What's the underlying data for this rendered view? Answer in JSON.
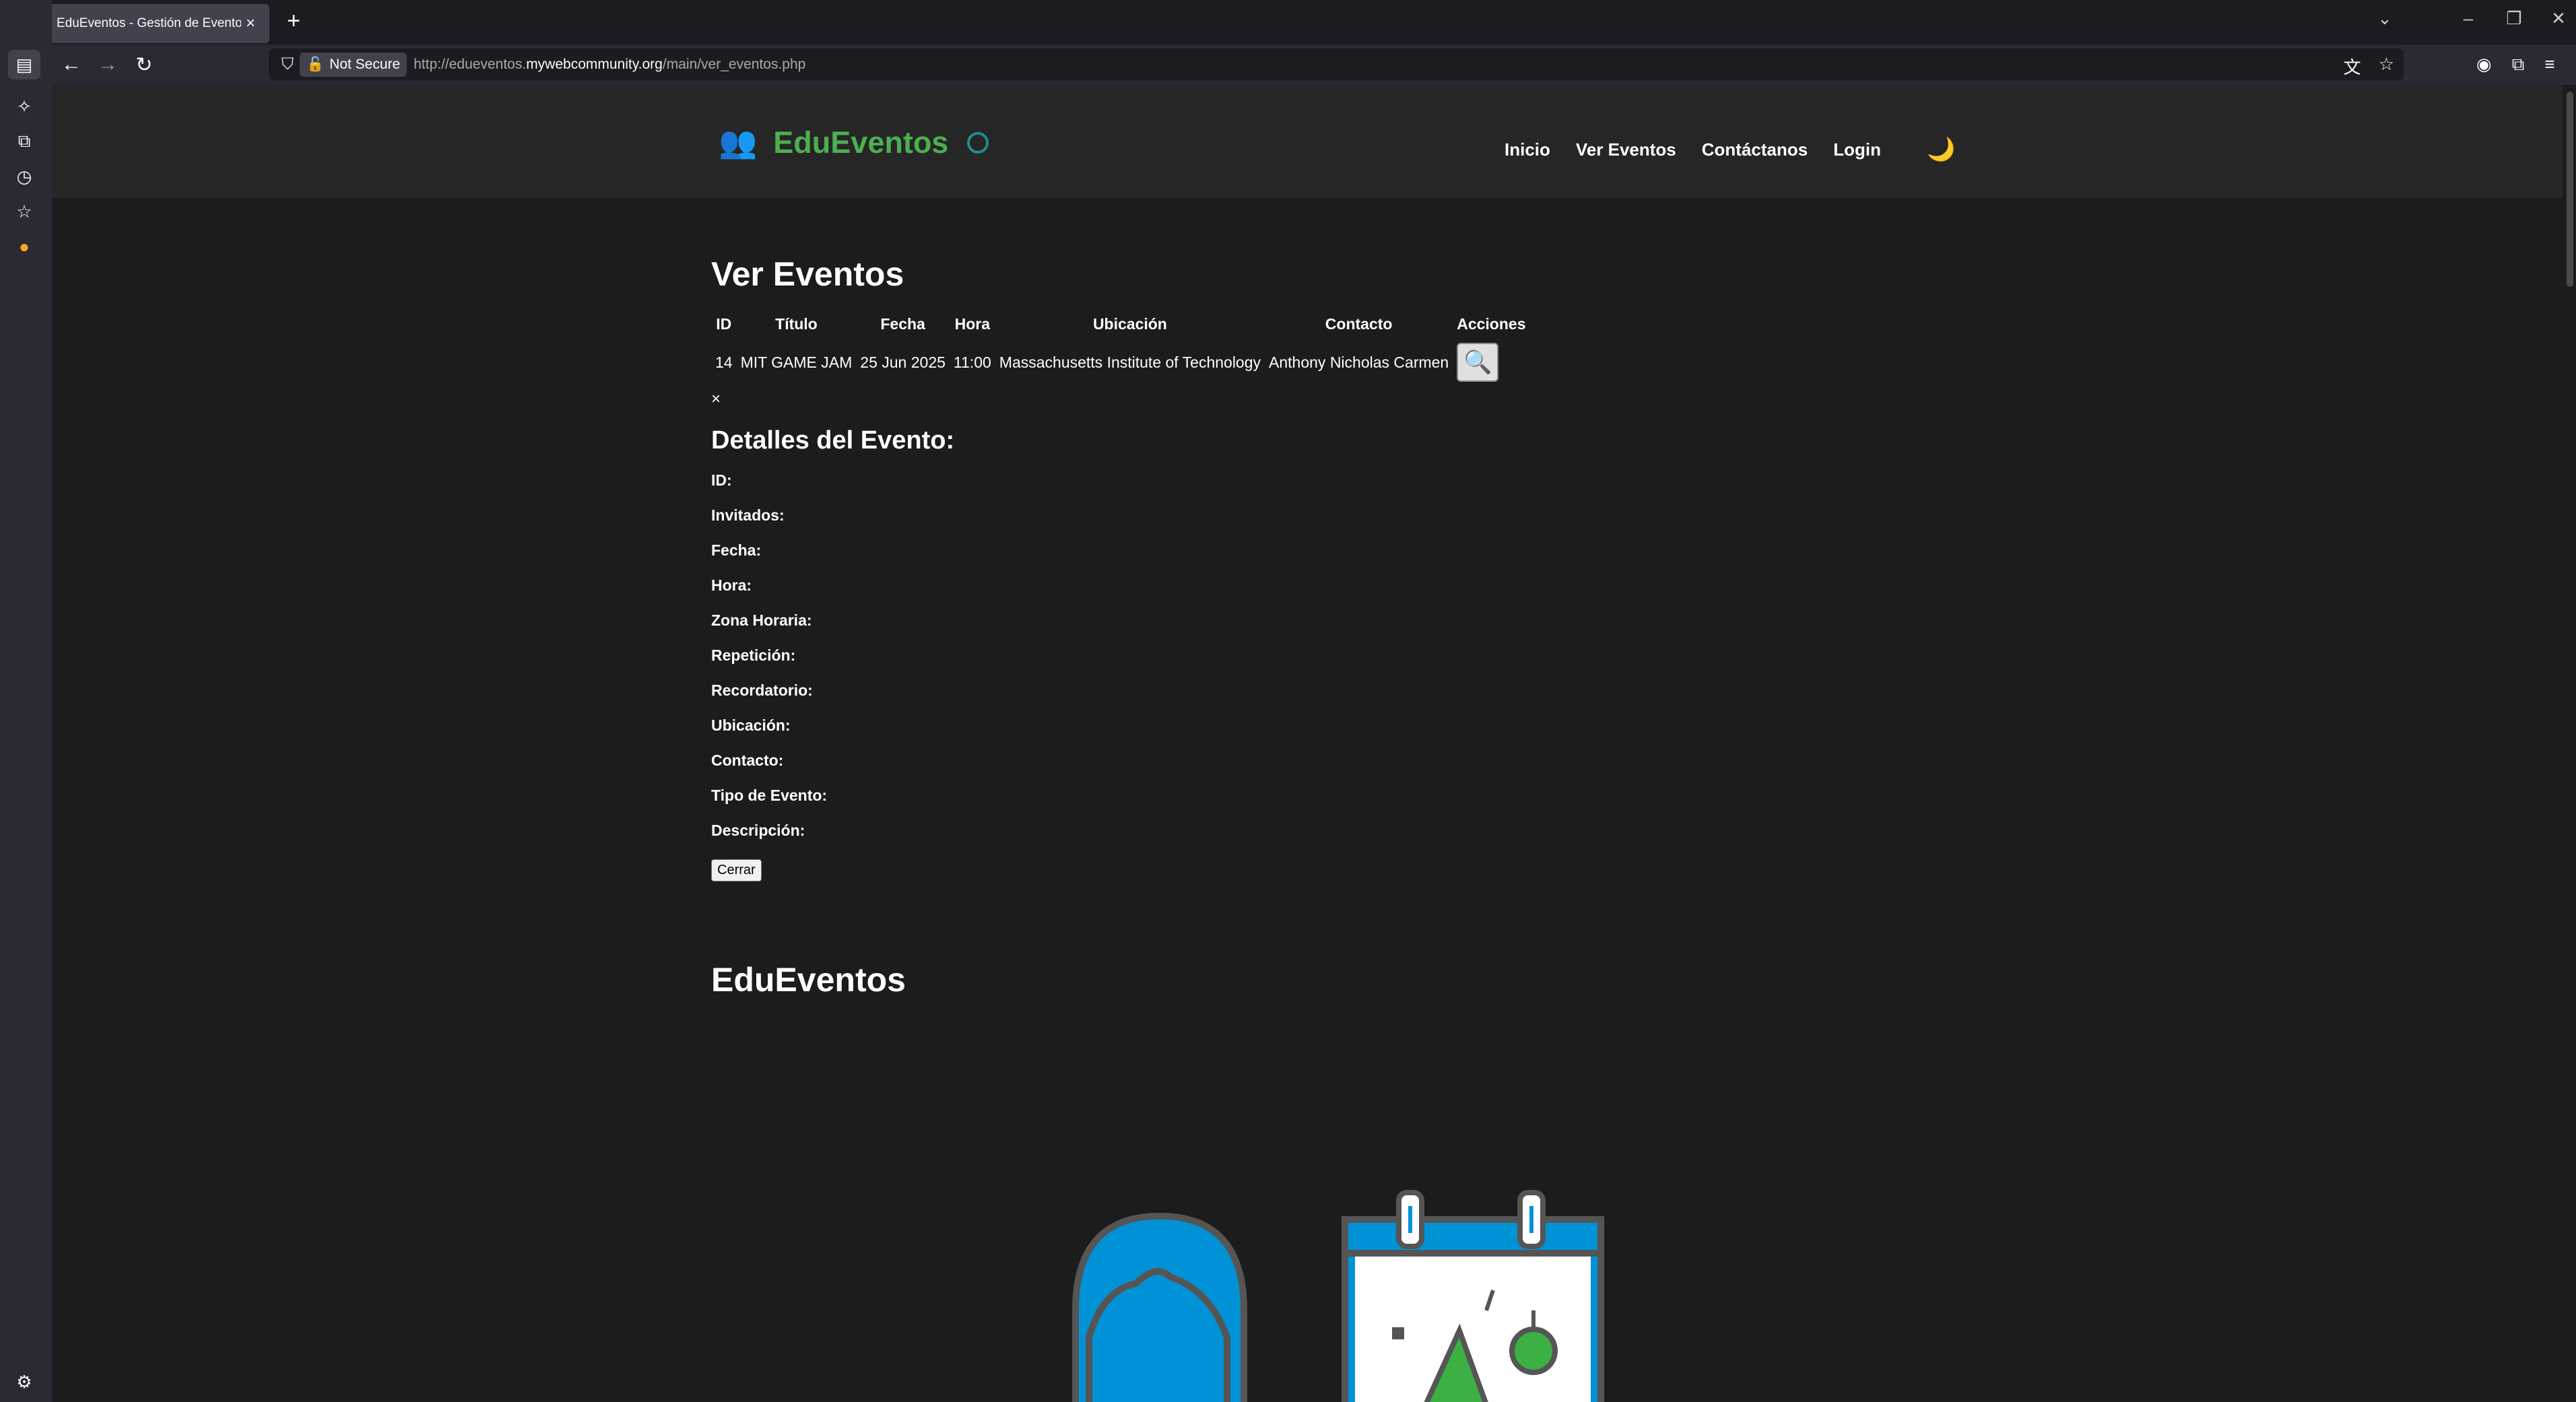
{
  "browser": {
    "tab_title": "EduEventos - Gestión de Eventos",
    "tab_close": "×",
    "new_tab": "+",
    "security_label": "Not Secure",
    "url_prefix": "http://edueventos.",
    "url_host": "mywebcommunity.org",
    "url_path": "/main/ver_eventos.php",
    "window_controls": [
      "–",
      "❐",
      "✕"
    ]
  },
  "site": {
    "brand": "EduEventos",
    "nav": [
      "Inicio",
      "Ver Eventos",
      "Contáctanos",
      "Login"
    ],
    "theme_toggle": "🌙"
  },
  "main": {
    "title": "Ver Eventos",
    "table": {
      "headers": [
        "ID",
        "Título",
        "Fecha",
        "Hora",
        "Ubicación",
        "Contacto",
        "Acciones"
      ],
      "rows": [
        {
          "id": "14",
          "titulo": "MIT GAME JAM",
          "fecha": "25 Jun 2025",
          "hora": "11:00",
          "ubicacion": "Massachusetts Institute of Technology",
          "contacto": "Anthony Nicholas Carmen"
        }
      ]
    },
    "close_x": "×",
    "details_title": "Detalles del Evento:",
    "details_fields": [
      "ID:",
      "Invitados:",
      "Fecha:",
      "Hora:",
      "Zona Horaria:",
      "Repetición:",
      "Recordatorio:",
      "Ubicación:",
      "Contacto:",
      "Tipo de Evento:",
      "Descripción:"
    ],
    "close_button": "Cerrar"
  },
  "footer": {
    "brand": "EduEventos"
  },
  "colors": {
    "brand_green": "#4caf50",
    "page_bg": "#1c1c1c",
    "header_bg": "#262626",
    "illustration_blue": "#0092d6"
  }
}
